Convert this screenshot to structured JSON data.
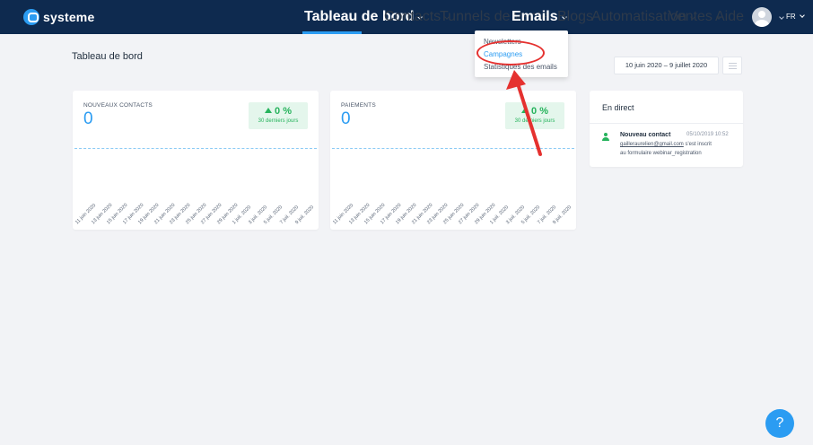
{
  "header": {
    "logo_text": "systeme",
    "nav": [
      {
        "label": "Tableau de bord",
        "has_chevron": true
      },
      {
        "label": "Contacts",
        "has_chevron": true
      },
      {
        "label": "Tunnels de vente",
        "has_chevron": false
      },
      {
        "label": "Emails",
        "has_chevron": true
      },
      {
        "label": "Blogs",
        "has_chevron": false
      },
      {
        "label": "Automatisation",
        "has_chevron": true
      },
      {
        "label": "Ventes",
        "has_chevron": true
      },
      {
        "label": "Aide",
        "has_chevron": false
      }
    ],
    "language": "FR"
  },
  "emails_dropdown": {
    "items": [
      "Newsletters",
      "Campagnes",
      "Statistiques des emails"
    ]
  },
  "page": {
    "title": "Tableau de bord",
    "date_range": "10 juin 2020  –  9 juillet 2020"
  },
  "cards": {
    "contacts": {
      "label": "NOUVEAUX CONTACTS",
      "value": "0",
      "pct": "0 %",
      "period": "30 derniers jours"
    },
    "payments": {
      "label": "PAIEMENTS",
      "value": "0",
      "pct": "0 %",
      "period": "30 derniers jours"
    },
    "x_labels": [
      "11 juin 2020",
      "13 juin 2020",
      "15 juin 2020",
      "17 juin 2020",
      "19 juin 2020",
      "21 juin 2020",
      "23 juin 2020",
      "25 juin 2020",
      "27 juin 2020",
      "29 juin 2020",
      "1 juil. 2020",
      "3 juil. 2020",
      "5 juil. 2020",
      "7 juil. 2020",
      "9 juil. 2020"
    ]
  },
  "live": {
    "title": "En direct",
    "event": {
      "name": "Nouveau contact",
      "time": "05/10/2019 10:52",
      "email": "gailleraurelien@gmail.com",
      "text1": " s'est inscrit",
      "text2": "au formulaire webinar_registration"
    }
  },
  "help": {
    "label": "?"
  },
  "colors": {
    "nav_bg": "#0e2a4f",
    "accent": "#2b9cf2",
    "success": "#26b35c",
    "annotation": "#e5312f"
  }
}
